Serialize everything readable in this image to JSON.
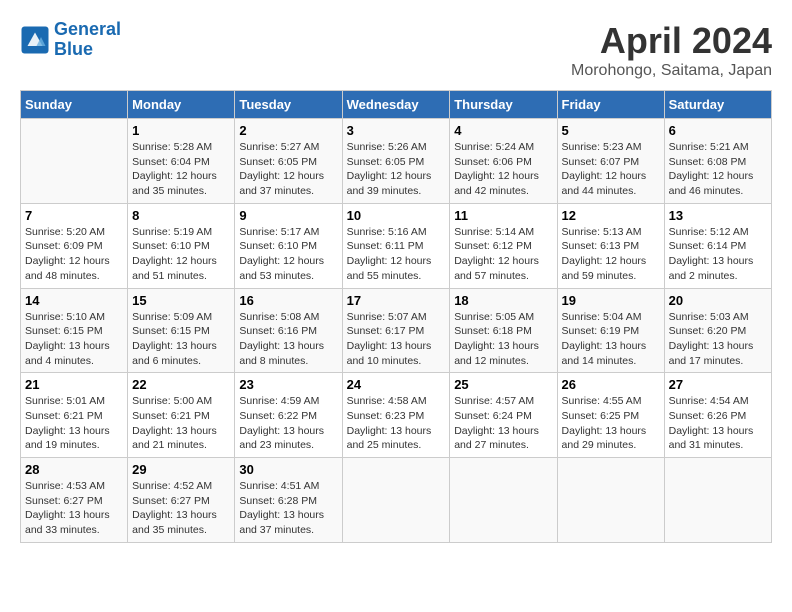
{
  "header": {
    "logo_line1": "General",
    "logo_line2": "Blue",
    "title": "April 2024",
    "subtitle": "Morohongo, Saitama, Japan"
  },
  "weekdays": [
    "Sunday",
    "Monday",
    "Tuesday",
    "Wednesday",
    "Thursday",
    "Friday",
    "Saturday"
  ],
  "weeks": [
    [
      {
        "day": "",
        "empty": true
      },
      {
        "day": "1",
        "sunrise": "5:28 AM",
        "sunset": "6:04 PM",
        "daylight": "12 hours and 35 minutes."
      },
      {
        "day": "2",
        "sunrise": "5:27 AM",
        "sunset": "6:05 PM",
        "daylight": "12 hours and 37 minutes."
      },
      {
        "day": "3",
        "sunrise": "5:26 AM",
        "sunset": "6:05 PM",
        "daylight": "12 hours and 39 minutes."
      },
      {
        "day": "4",
        "sunrise": "5:24 AM",
        "sunset": "6:06 PM",
        "daylight": "12 hours and 42 minutes."
      },
      {
        "day": "5",
        "sunrise": "5:23 AM",
        "sunset": "6:07 PM",
        "daylight": "12 hours and 44 minutes."
      },
      {
        "day": "6",
        "sunrise": "5:21 AM",
        "sunset": "6:08 PM",
        "daylight": "12 hours and 46 minutes."
      }
    ],
    [
      {
        "day": "7",
        "sunrise": "5:20 AM",
        "sunset": "6:09 PM",
        "daylight": "12 hours and 48 minutes."
      },
      {
        "day": "8",
        "sunrise": "5:19 AM",
        "sunset": "6:10 PM",
        "daylight": "12 hours and 51 minutes."
      },
      {
        "day": "9",
        "sunrise": "5:17 AM",
        "sunset": "6:10 PM",
        "daylight": "12 hours and 53 minutes."
      },
      {
        "day": "10",
        "sunrise": "5:16 AM",
        "sunset": "6:11 PM",
        "daylight": "12 hours and 55 minutes."
      },
      {
        "day": "11",
        "sunrise": "5:14 AM",
        "sunset": "6:12 PM",
        "daylight": "12 hours and 57 minutes."
      },
      {
        "day": "12",
        "sunrise": "5:13 AM",
        "sunset": "6:13 PM",
        "daylight": "12 hours and 59 minutes."
      },
      {
        "day": "13",
        "sunrise": "5:12 AM",
        "sunset": "6:14 PM",
        "daylight": "13 hours and 2 minutes."
      }
    ],
    [
      {
        "day": "14",
        "sunrise": "5:10 AM",
        "sunset": "6:15 PM",
        "daylight": "13 hours and 4 minutes."
      },
      {
        "day": "15",
        "sunrise": "5:09 AM",
        "sunset": "6:15 PM",
        "daylight": "13 hours and 6 minutes."
      },
      {
        "day": "16",
        "sunrise": "5:08 AM",
        "sunset": "6:16 PM",
        "daylight": "13 hours and 8 minutes."
      },
      {
        "day": "17",
        "sunrise": "5:07 AM",
        "sunset": "6:17 PM",
        "daylight": "13 hours and 10 minutes."
      },
      {
        "day": "18",
        "sunrise": "5:05 AM",
        "sunset": "6:18 PM",
        "daylight": "13 hours and 12 minutes."
      },
      {
        "day": "19",
        "sunrise": "5:04 AM",
        "sunset": "6:19 PM",
        "daylight": "13 hours and 14 minutes."
      },
      {
        "day": "20",
        "sunrise": "5:03 AM",
        "sunset": "6:20 PM",
        "daylight": "13 hours and 17 minutes."
      }
    ],
    [
      {
        "day": "21",
        "sunrise": "5:01 AM",
        "sunset": "6:21 PM",
        "daylight": "13 hours and 19 minutes."
      },
      {
        "day": "22",
        "sunrise": "5:00 AM",
        "sunset": "6:21 PM",
        "daylight": "13 hours and 21 minutes."
      },
      {
        "day": "23",
        "sunrise": "4:59 AM",
        "sunset": "6:22 PM",
        "daylight": "13 hours and 23 minutes."
      },
      {
        "day": "24",
        "sunrise": "4:58 AM",
        "sunset": "6:23 PM",
        "daylight": "13 hours and 25 minutes."
      },
      {
        "day": "25",
        "sunrise": "4:57 AM",
        "sunset": "6:24 PM",
        "daylight": "13 hours and 27 minutes."
      },
      {
        "day": "26",
        "sunrise": "4:55 AM",
        "sunset": "6:25 PM",
        "daylight": "13 hours and 29 minutes."
      },
      {
        "day": "27",
        "sunrise": "4:54 AM",
        "sunset": "6:26 PM",
        "daylight": "13 hours and 31 minutes."
      }
    ],
    [
      {
        "day": "28",
        "sunrise": "4:53 AM",
        "sunset": "6:27 PM",
        "daylight": "13 hours and 33 minutes."
      },
      {
        "day": "29",
        "sunrise": "4:52 AM",
        "sunset": "6:27 PM",
        "daylight": "13 hours and 35 minutes."
      },
      {
        "day": "30",
        "sunrise": "4:51 AM",
        "sunset": "6:28 PM",
        "daylight": "13 hours and 37 minutes."
      },
      {
        "day": "",
        "empty": true
      },
      {
        "day": "",
        "empty": true
      },
      {
        "day": "",
        "empty": true
      },
      {
        "day": "",
        "empty": true
      }
    ]
  ]
}
